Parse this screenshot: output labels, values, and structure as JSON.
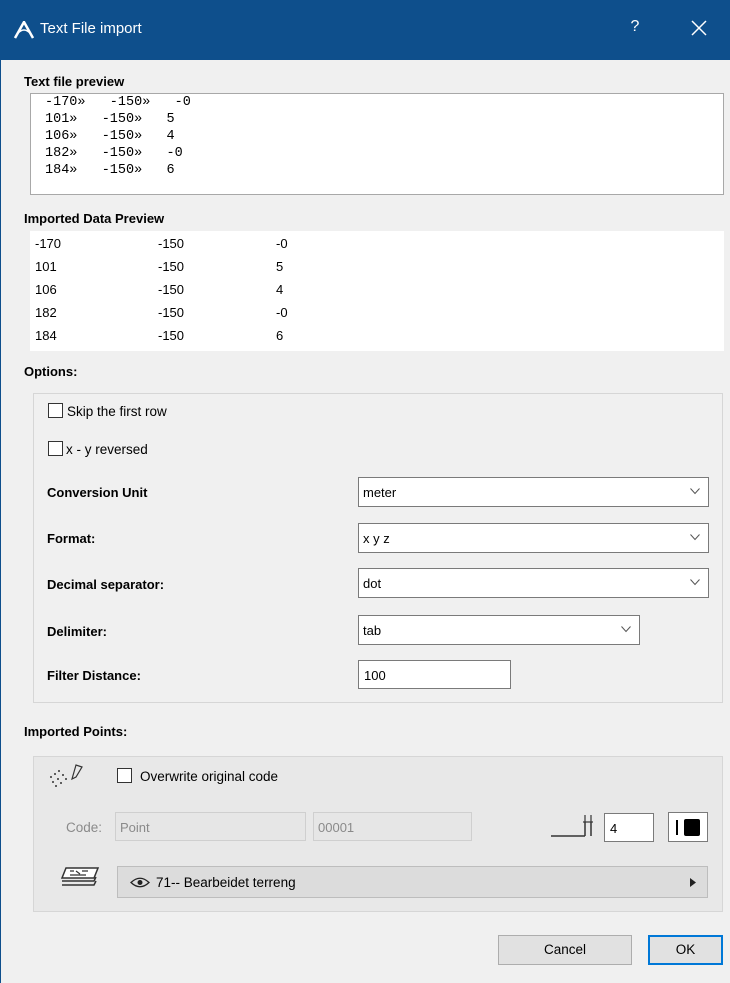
{
  "window": {
    "title": "Text File import",
    "help_label": "?"
  },
  "text_preview": {
    "heading": "Text file preview",
    "lines": [
      "-170»   -150»   -0",
      "101»   -150»   5",
      "106»   -150»   4",
      "182»   -150»   -0",
      "184»   -150»   6"
    ]
  },
  "imported_preview": {
    "heading": "Imported Data Preview",
    "rows": [
      [
        "-170",
        "-150",
        "-0"
      ],
      [
        "101",
        "-150",
        "5"
      ],
      [
        "106",
        "-150",
        "4"
      ],
      [
        "182",
        "-150",
        "-0"
      ],
      [
        "184",
        "-150",
        "6"
      ]
    ]
  },
  "options": {
    "heading": "Options:",
    "skip_first_row": {
      "label": "Skip the first row",
      "checked": false
    },
    "xy_reversed": {
      "label": "x - y reversed",
      "checked": false
    },
    "conversion_unit": {
      "label": "Conversion Unit",
      "value": "meter"
    },
    "format": {
      "label": "Format:",
      "value": "x y z"
    },
    "decimal_separator": {
      "label": "Decimal separator:",
      "value": "dot"
    },
    "delimiter": {
      "label": "Delimiter:",
      "value": "tab"
    },
    "filter_distance": {
      "label": "Filter Distance:",
      "value": "100"
    }
  },
  "imported_points": {
    "heading": "Imported Points:",
    "overwrite_code": {
      "label": "Overwrite original code",
      "checked": false
    },
    "code_label": "Code:",
    "code_name": "Point",
    "code_number": "00001",
    "pen_number": "4",
    "layer": "71-- Bearbeidet terreng"
  },
  "buttons": {
    "cancel": "Cancel",
    "ok": "OK"
  },
  "colors": {
    "titlebar": "#0e4f8c",
    "ok_border": "#0078d7"
  },
  "icons": [
    "archicad-icon",
    "help-icon",
    "close-icon",
    "chevron-down-icon",
    "point-code-icon",
    "pen-icon",
    "pen-color-icon",
    "layer-icon",
    "eye-icon",
    "triangle-right-icon"
  ]
}
